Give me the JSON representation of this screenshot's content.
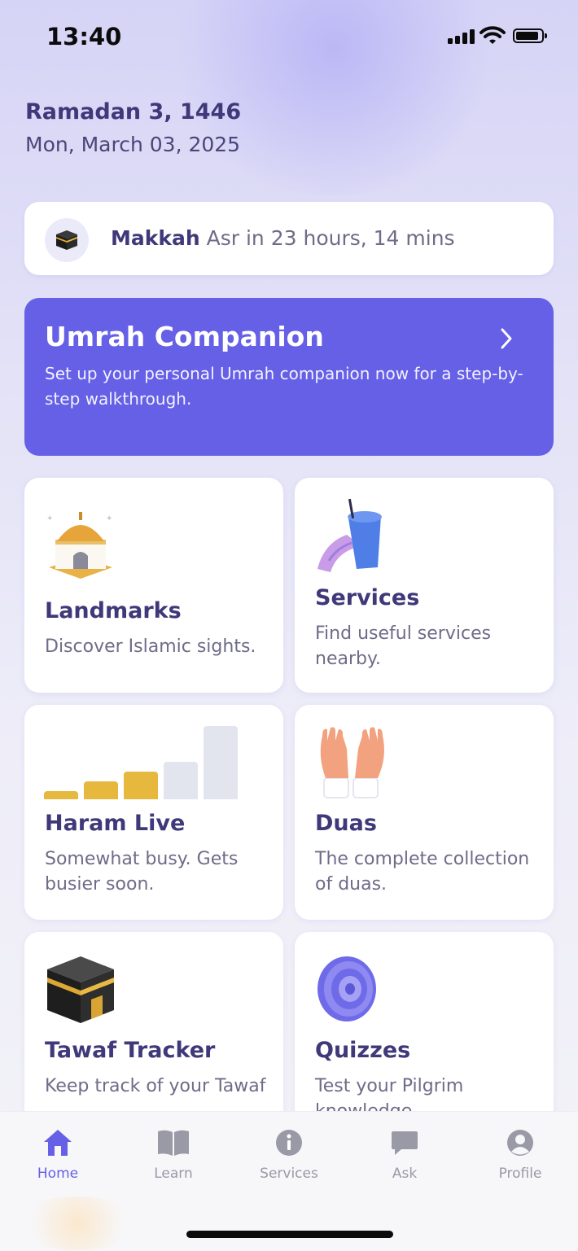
{
  "status_bar": {
    "time": "13:40"
  },
  "header": {
    "hijri_date": "Ramadan 3, 1446",
    "gregorian_date": "Mon, March 03, 2025"
  },
  "prayer_card": {
    "city": "Makkah",
    "next_prayer": "Asr in 23 hours, 14 mins"
  },
  "umrah_banner": {
    "title": "Umrah Companion",
    "description": "Set up your personal Umrah companion now for a step-by-step walkthrough."
  },
  "tiles": [
    {
      "title": "Landmarks",
      "description": "Discover Islamic sights.",
      "icon": "mosque-icon"
    },
    {
      "title": "Services",
      "description": "Find useful services nearby.",
      "icon": "drink-cup-icon"
    },
    {
      "title": "Haram Live",
      "description": "Somewhat busy. Gets busier soon.",
      "icon": "crowd-bars-icon",
      "busyness_level": 3,
      "busyness_max": 5
    },
    {
      "title": "Duas",
      "description": "The complete collection of duas.",
      "icon": "praying-hands-icon"
    },
    {
      "title": "Tawaf Tracker",
      "description": "Keep track of your Tawaf",
      "icon": "kaaba-icon"
    },
    {
      "title": "Quizzes",
      "description": "Test your Pilgrim knowledge",
      "icon": "target-icon"
    }
  ],
  "tab_bar": {
    "items": [
      {
        "label": "Home",
        "icon": "home-icon",
        "active": true
      },
      {
        "label": "Learn",
        "icon": "book-icon",
        "active": false
      },
      {
        "label": "Services",
        "icon": "info-icon",
        "active": false
      },
      {
        "label": "Ask",
        "icon": "chat-icon",
        "active": false
      },
      {
        "label": "Profile",
        "icon": "profile-icon",
        "active": false
      }
    ]
  },
  "colors": {
    "accent": "#6560e6",
    "title_text": "#3f3879",
    "body_text": "#6e6c88",
    "busy_filled": "#e6b93e",
    "busy_empty": "#e3e5ee"
  }
}
